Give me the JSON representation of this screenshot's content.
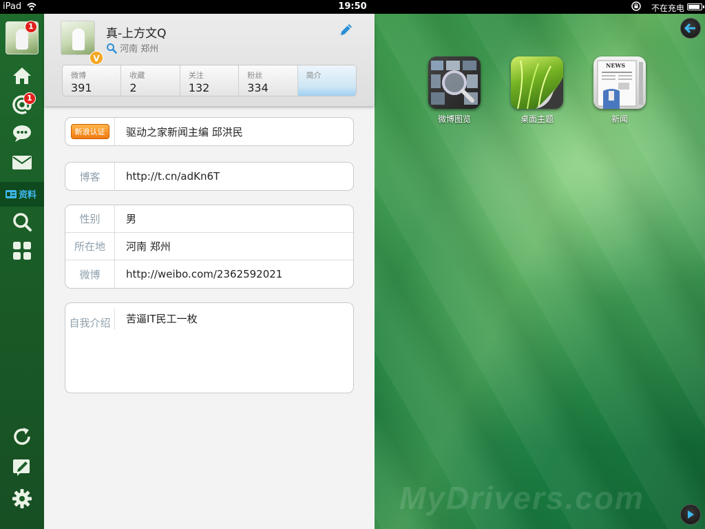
{
  "status": {
    "carrier": "iPad",
    "time": "19:50",
    "charging": "不在充电",
    "battery_level": 0.9
  },
  "sidebar": {
    "avatar_badge": "1",
    "mention_badge": "1",
    "active_label": "资料",
    "icons": [
      "home-icon",
      "at-icon",
      "chat-icon",
      "mail-icon",
      "profile-icon",
      "search-icon",
      "apps-icon",
      "refresh-icon",
      "compose-icon",
      "settings-icon"
    ]
  },
  "profile": {
    "name": "真-上方文Q",
    "location": "河南 郑州",
    "verified_badge": "V",
    "stats": [
      {
        "label": "微博",
        "value": "391"
      },
      {
        "label": "收藏",
        "value": "2"
      },
      {
        "label": "关注",
        "value": "132"
      },
      {
        "label": "粉丝",
        "value": "334"
      },
      {
        "label": "简介",
        "value": ""
      }
    ],
    "verify_tag": "新浪认证",
    "verify_text": "驱动之家新闻主编 邱洪民",
    "blog_label": "博客",
    "blog_value": "http://t.cn/adKn6T",
    "gender_label": "性别",
    "gender_value": "男",
    "loc_label": "所在地",
    "loc_value": "河南 郑州",
    "weibo_label": "微博",
    "weibo_value": "http://weibo.com/2362592021",
    "intro_label": "自我介绍",
    "intro_value": "苦逼IT民工一枚"
  },
  "apps": [
    {
      "name": "微博图览"
    },
    {
      "name": "桌面主题"
    },
    {
      "name": "新闻"
    }
  ],
  "watermark": "MyDrivers.com"
}
